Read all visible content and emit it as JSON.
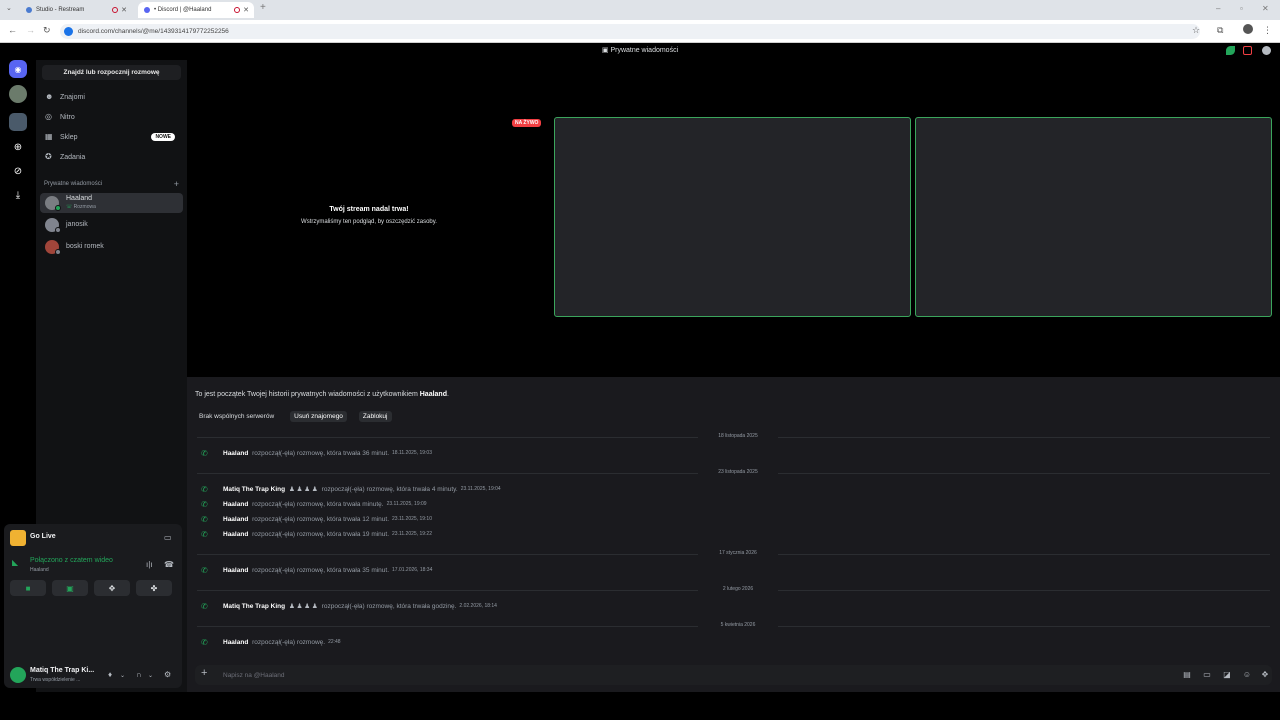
{
  "browser": {
    "tabs": [
      {
        "title": "Studio - Restream"
      },
      {
        "title": "• Discord | @Haaland"
      }
    ],
    "url": "discord.com/channels/@me/1439314179772252256"
  },
  "topbar": {
    "title": "Prywatne wiadomości"
  },
  "sidebar": {
    "search": "Znajdź lub rozpocznij rozmowę",
    "nav": [
      {
        "label": "Znajomi"
      },
      {
        "label": "Nitro"
      },
      {
        "label": "Sklep",
        "badge": "NOWE"
      },
      {
        "label": "Zadania"
      }
    ],
    "section_label": "Prywatne wiadomości",
    "dms": [
      {
        "name": "Haaland",
        "sub": "Rozmowa"
      },
      {
        "name": "janosik"
      },
      {
        "name": "boski romek"
      }
    ]
  },
  "golive": {
    "title": "Go Live"
  },
  "voice": {
    "status": "Połączono z czatem wideo",
    "channel": "Haaland"
  },
  "user": {
    "name": "Matiq The Trap Ki...",
    "status": "Trwa współdzielenie ..."
  },
  "stream": {
    "paused_title": "Twój stream nadal trwa!",
    "paused_sub": "Wstrzymaliśmy ten podgląd, by oszczędzić zasoby.",
    "live_badge": "NA ŻYWO"
  },
  "chat": {
    "intro_prefix": "To jest początek Twojej historii prywatnych wiadomości z użytkownikiem ",
    "intro_user": "Haaland",
    "intro_suffix": ".",
    "buttons": [
      "Brak wspólnych serwerów",
      "Usuń znajomego",
      "Zablokuj"
    ],
    "dividers": [
      "18 listopada 2025",
      "23 listopada 2025",
      "17 stycznia 2026",
      "2 lutego 2026",
      "5 kwietnia 2026"
    ],
    "messages": [
      {
        "who": "Haaland",
        "text": "rozpoczął(-ęła) rozmowę, która trwała 36 minut.",
        "time": "18.11.2025, 19:03"
      },
      {
        "who": "Matiq The Trap King",
        "text": "rozpoczął(-ęła) rozmowę, która trwała 4 minuty.",
        "time": "23.11.2025, 19:04"
      },
      {
        "who": "Haaland",
        "text": "rozpoczął(-ęła) rozmowę, która trwała minutę.",
        "time": "23.11.2025, 19:09"
      },
      {
        "who": "Haaland",
        "text": "rozpoczął(-ęła) rozmowę, która trwała 12 minut.",
        "time": "23.11.2025, 19:10"
      },
      {
        "who": "Haaland",
        "text": "rozpoczął(-ęła) rozmowę, która trwała 19 minut.",
        "time": "23.11.2025, 19:22"
      },
      {
        "who": "Haaland",
        "text": "rozpoczął(-ęła) rozmowę, która trwała 35 minut.",
        "time": "17.01.2026, 18:34"
      },
      {
        "who": "Matiq The Trap King",
        "text": "rozpoczął(-ęła) rozmowę, która trwała godzinę.",
        "time": "2.02.2026, 18:14"
      },
      {
        "who": "Haaland",
        "text": "rozpoczął(-ęła) rozmowę.",
        "time": "22:48"
      }
    ],
    "composer_placeholder": "Napisz na @Haaland"
  }
}
